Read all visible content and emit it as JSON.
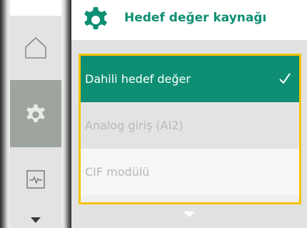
{
  "header": {
    "title": "Hedef değer kaynağı",
    "icon": "gear-icon",
    "accent_color": "#0e8f73"
  },
  "nav": {
    "items": [
      {
        "icon": "home-icon",
        "active": false
      },
      {
        "icon": "gear-icon",
        "active": true
      },
      {
        "icon": "diagnostics-icon",
        "active": false
      }
    ],
    "scroll_icon": "chevron-down-icon"
  },
  "list": {
    "highlight_color": "#f5c400",
    "items": [
      {
        "label": "Dahili hedef değer",
        "selected": true,
        "check_icon": "checkmark-icon"
      },
      {
        "label": "Analog giriş (AI2)",
        "selected": false
      },
      {
        "label": "CIF modülü",
        "selected": false
      }
    ]
  },
  "scroll_indicator_icon": "chevron-down-icon"
}
